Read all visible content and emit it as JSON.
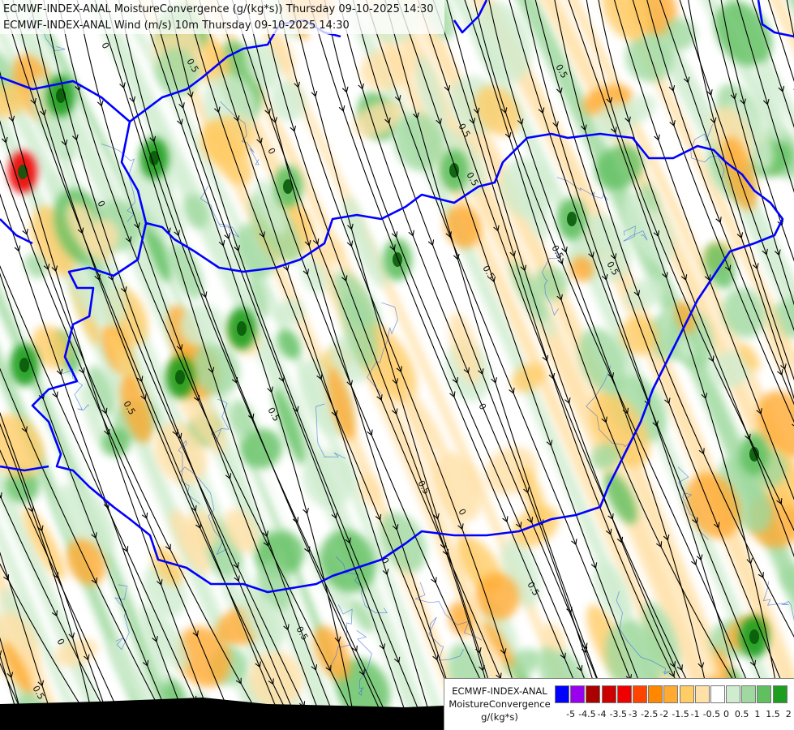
{
  "title": {
    "line1": "ECMWF-INDEX-ANAL MoistureConvergence (g/(kg*s)) Thursday 09-10-2025 14:30",
    "line2": "ECMWF-INDEX-ANAL Wind (m/s) 10m Thursday 09-10-2025 14:30"
  },
  "contour_labels": [
    "0",
    "0.5"
  ],
  "legend": {
    "title_lines": [
      "ECMWF-INDEX-ANAL",
      "MoistureConvergence",
      "g/(kg*s)"
    ],
    "ticks": [
      "-5",
      "-4.5",
      "-4",
      "-3.5",
      "-3",
      "-2.5",
      "-2",
      "-1.5",
      "-1",
      "-0.5",
      "0",
      "0.5",
      "1",
      "1.5",
      "2"
    ],
    "colors": [
      "#0000ff",
      "#9900ee",
      "#aa0000",
      "#cc0000",
      "#ee0000",
      "#ff4400",
      "#ff8800",
      "#ffaa33",
      "#ffcc66",
      "#ffe0a6",
      "#ffffff",
      "#cfeccf",
      "#9fd99f",
      "#60c060",
      "#1e9e1e"
    ]
  },
  "colors": {
    "border": "#0000ff",
    "river": "#3366dd",
    "streamline": "#000000",
    "water_body": "#000000"
  }
}
